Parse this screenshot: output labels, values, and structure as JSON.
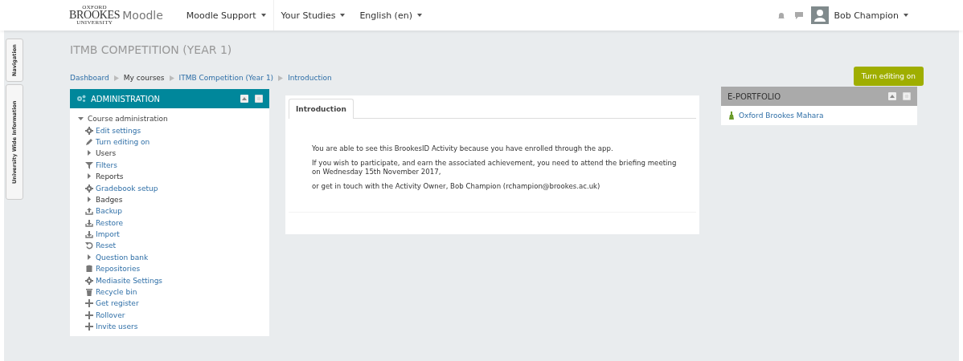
{
  "header": {
    "logo": {
      "line_1": "OXFORD",
      "line_2": "BROOKES",
      "line_3": "UNIVERSITY",
      "site": "Moodle"
    },
    "menus": [
      "Moodle Support",
      "Your Studies",
      "English (en)"
    ],
    "user": "Bob Champion"
  },
  "side_tabs": [
    "Navigation",
    "University Wide Information"
  ],
  "page_title": "ITMB COMPETITION (YEAR 1)",
  "breadcrumb": [
    {
      "label": "Dashboard",
      "kind": "link"
    },
    {
      "label": "My courses",
      "kind": "text"
    },
    {
      "label": "ITMB Competition (Year 1)",
      "kind": "link"
    },
    {
      "label": "Introduction",
      "kind": "link"
    }
  ],
  "edit_button": "Turn editing on",
  "administration": {
    "title": "ADMINISTRATION",
    "tree": [
      {
        "label": "Course administration",
        "expanded": true,
        "children": [
          {
            "label": "Edit settings",
            "kind": "link"
          },
          {
            "label": "Turn editing on",
            "kind": "link"
          },
          {
            "label": "Users",
            "kind": "branch",
            "expanded": false
          },
          {
            "label": "Filters",
            "kind": "link"
          },
          {
            "label": "Reports",
            "kind": "branch",
            "expanded": false
          },
          {
            "label": "Gradebook setup",
            "kind": "link"
          },
          {
            "label": "Badges",
            "kind": "branch",
            "expanded": false
          },
          {
            "label": "Backup",
            "kind": "link"
          },
          {
            "label": "Restore",
            "kind": "link"
          },
          {
            "label": "Import",
            "kind": "link"
          },
          {
            "label": "Reset",
            "kind": "link"
          },
          {
            "label": "Question bank",
            "kind": "branch-link",
            "expanded": false
          },
          {
            "label": "Repositories",
            "kind": "link"
          },
          {
            "label": "Mediasite Settings",
            "kind": "link"
          },
          {
            "label": "Recycle bin",
            "kind": "link"
          },
          {
            "label": "Get register",
            "kind": "link"
          },
          {
            "label": "Rollover",
            "kind": "link"
          },
          {
            "label": "Invite users",
            "kind": "link"
          }
        ]
      }
    ]
  },
  "main": {
    "tabs": [
      {
        "label": "Introduction",
        "selected": true
      }
    ],
    "paragraphs": [
      "You are able to see this BrookesID Activity because you have enrolled through the app.",
      "If you wish to participate, and earn the associated achievement, you need to attend the briefing meeting on Wednesday 15th November 2017,",
      "or get in touch with the Activity Owner, Bob Champion (rchampion@brookes.ac.uk)"
    ]
  },
  "eportfolio": {
    "title": "E-PORTFOLIO",
    "links": [
      "Oxford Brookes Mahara"
    ]
  }
}
